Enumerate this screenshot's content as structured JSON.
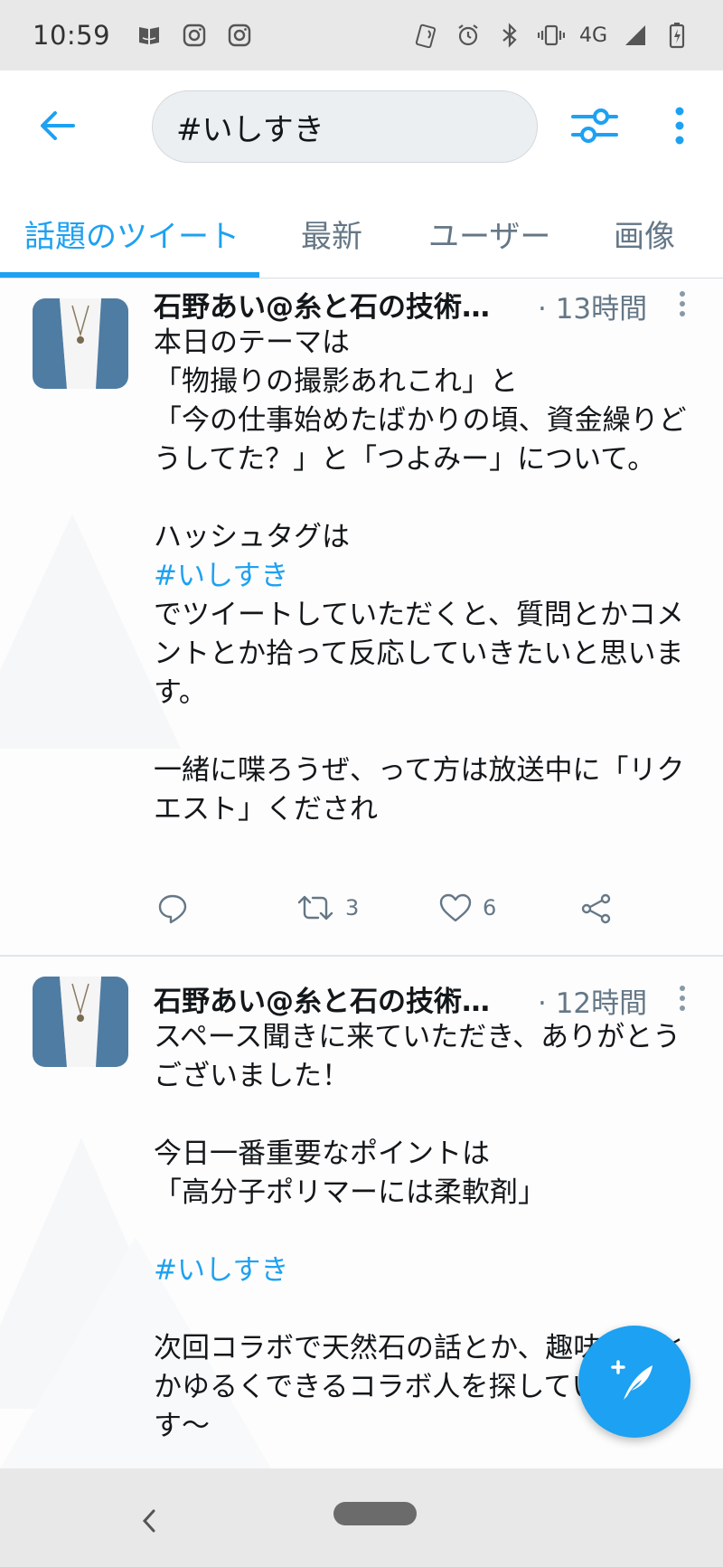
{
  "status_bar": {
    "time": "10:59",
    "network": "4G",
    "left_icons": [
      "amazon-icon",
      "instagram-icon",
      "instagram-icon"
    ],
    "right_icons": [
      "nfc-icon",
      "alarm-icon",
      "bluetooth-icon",
      "vibrate-icon",
      "signal-icon",
      "battery-charging-icon"
    ]
  },
  "header": {
    "search_value": "#いしすき",
    "icons": [
      "back-arrow-icon",
      "filter-sliders-icon",
      "more-vertical-icon"
    ]
  },
  "tabs": [
    {
      "label": "話題のツイート",
      "active": true
    },
    {
      "label": "最新",
      "active": false
    },
    {
      "label": "ユーザー",
      "active": false
    },
    {
      "label": "画像",
      "active": false
    }
  ],
  "tweets": [
    {
      "name": "石野あい@糸と石の技術…",
      "time": "· 13時間",
      "body_1": "本日のテーマは\n「物撮りの撮影あれこれ」と\n「今の仕事始めたばかりの頃、資金繰りどうしてた？」と「つよみー」について。\n\nハッシュタグは",
      "hashtag": "#いしすき",
      "body_2": "でツイートしていただくと、質問とかコメントとか拾って反応していきたいと思います。\n\n一緒に喋ろうぜ、って方は放送中に「リクエスト」くだされ",
      "retweets": "3",
      "likes": "6"
    },
    {
      "name": "石野あい@糸と石の技術…",
      "time": "· 12時間",
      "body_1": "スペース聞きに来ていただき、ありがとうございました！\n\n今日一番重要なポイントは\n「高分子ポリマーには柔軟剤」",
      "hashtag": "#いしすき",
      "body_2": "次回コラボで天然石の話とか、趣味の話とかゆるくできるコラボ人を探していきます〜"
    }
  ],
  "colors": {
    "accent": "#1da1f2",
    "secondary_text": "#657786",
    "system_bar": "#e8e8e8"
  }
}
